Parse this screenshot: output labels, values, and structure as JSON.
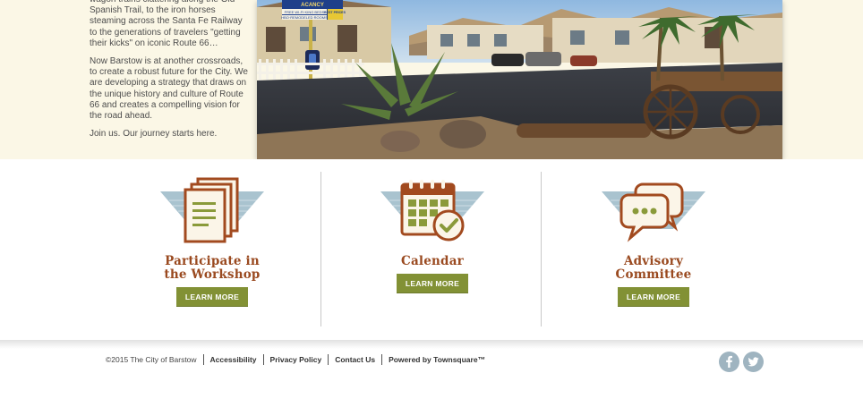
{
  "hero": {
    "paragraph1": "wagon trains clattering along the Old Spanish Trail, to the iron horses steaming across the Santa Fe Railway to the generations of travelers \"getting their kicks\" on iconic Route 66…",
    "paragraph2": "Now Barstow is at another crossroads, to create a robust future for the City. We are developing a strategy that draws on the unique history and culture of Route 66 and creates a compelling vision for the road ahead.",
    "paragraph3": "Join us. Our journey starts here.",
    "sign_line1": "ACANCY",
    "sign_line2": "FREE WI-FI·KING BEDS",
    "sign_line3": "HBO·REMODELED ROOMS",
    "sign_badge": "BEST PRICES"
  },
  "cards": [
    {
      "title_line1": "Participate in",
      "title_line2": "the Workshop",
      "button": "LEARN MORE",
      "icon": "documents-icon"
    },
    {
      "title_line1": "Calendar",
      "title_line2": "",
      "button": "LEARN MORE",
      "icon": "calendar-check-icon"
    },
    {
      "title_line1": "Advisory",
      "title_line2": "Committee",
      "button": "LEARN MORE",
      "icon": "speech-bubbles-icon"
    }
  ],
  "footer": {
    "copyright": "©2015 The City of Barstow",
    "links": [
      "Accessibility",
      "Privacy Policy",
      "Contact Us",
      "Powered by Townsquare™"
    ],
    "social": [
      "facebook-icon",
      "twitter-icon"
    ]
  },
  "colors": {
    "hero_bg": "#fbf7e6",
    "title_brown": "#9a4a20",
    "button_olive": "#829135",
    "icon_brown": "#a24a1f",
    "icon_green": "#8a9a3a",
    "icon_blue": "#a9c3cf",
    "social_grey_blue": "#9fb4c0"
  }
}
